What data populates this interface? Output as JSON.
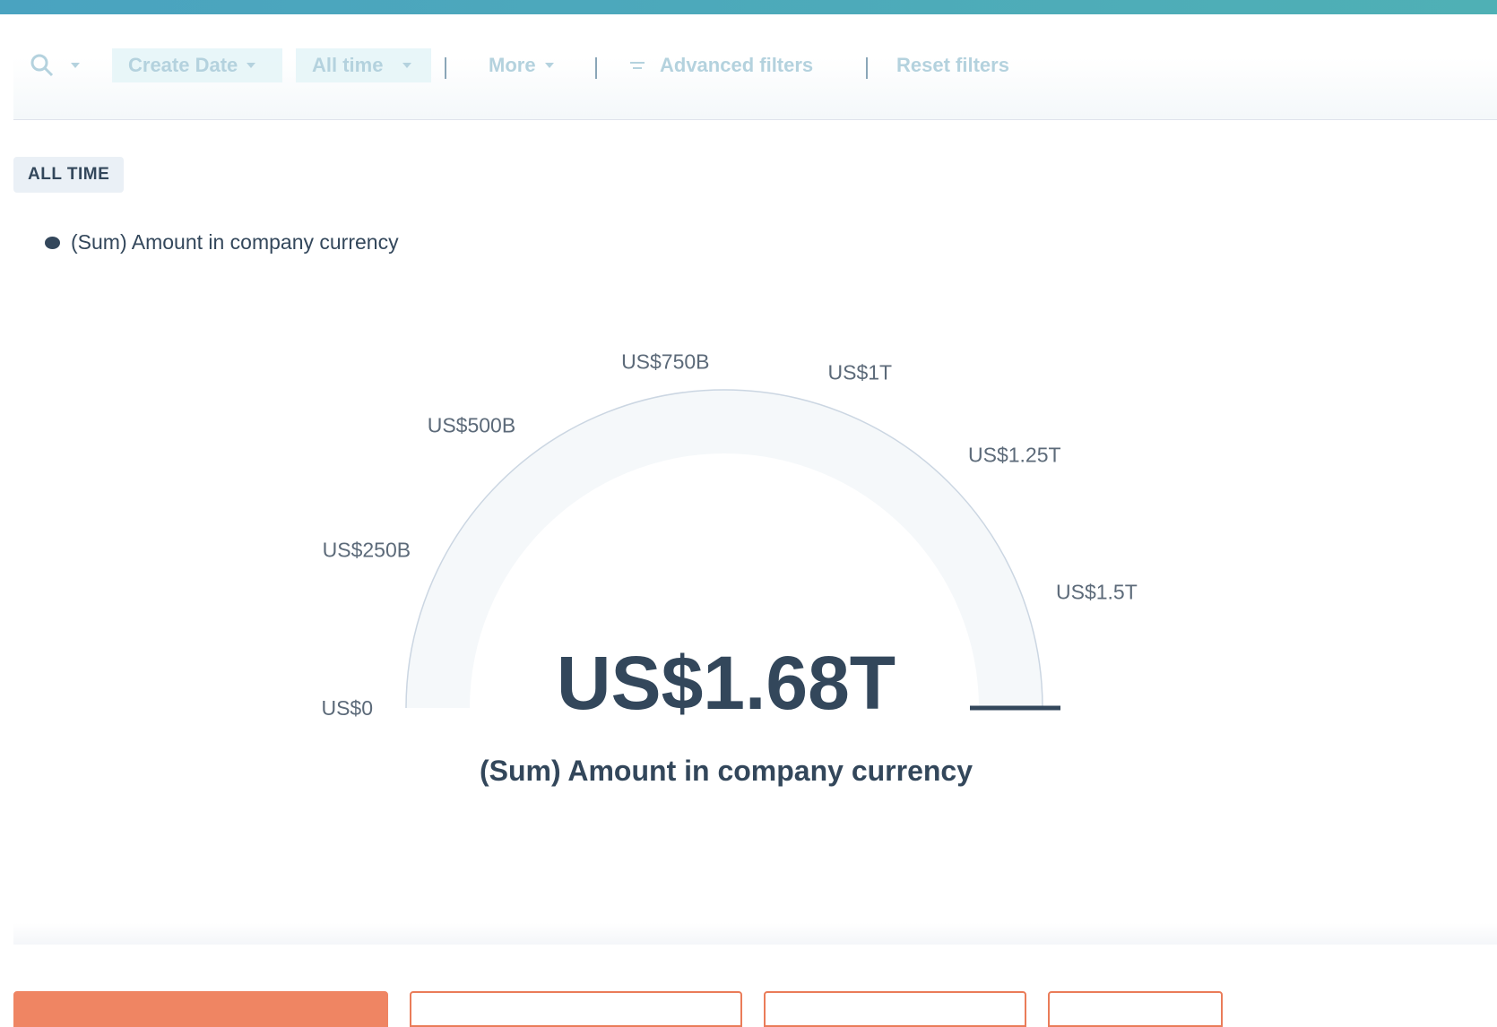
{
  "filters": {
    "date_property": "Create Date",
    "date_range": "All time",
    "more": "More",
    "advanced": "Advanced filters",
    "reset": "Reset filters"
  },
  "period_badge": "ALL TIME",
  "legend": {
    "series_name": "(Sum) Amount in company currency"
  },
  "chart_data": {
    "type": "gauge",
    "value": 1680000000000,
    "value_label": "US$1.68T",
    "caption": "(Sum) Amount in company currency",
    "min": 0,
    "max": 1680000000000,
    "ticks": [
      {
        "value": 0,
        "label": "US$0"
      },
      {
        "value": 250000000000,
        "label": "US$250B"
      },
      {
        "value": 500000000000,
        "label": "US$500B"
      },
      {
        "value": 750000000000,
        "label": "US$750B"
      },
      {
        "value": 1000000000000,
        "label": "US$1T"
      },
      {
        "value": 1250000000000,
        "label": "US$1.25T"
      },
      {
        "value": 1500000000000,
        "label": "US$1.5T"
      }
    ],
    "track_color": "#f5f8fa",
    "outline_color": "#cbd6e2",
    "needle_color": "#33475b"
  },
  "bottom_buttons": [
    "",
    "",
    "",
    ""
  ]
}
